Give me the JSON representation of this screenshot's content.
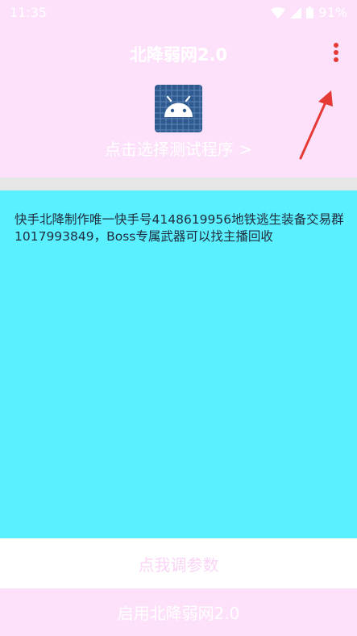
{
  "status_bar": {
    "time": "11:35",
    "battery_percent": "91%",
    "icons": [
      "wifi-icon",
      "signal-icon",
      "battery-icon"
    ]
  },
  "header": {
    "title": "北降弱网2.0",
    "app_icon": "android-icon",
    "select_program": "点击选择测试程序 >",
    "menu_icon": "more-vert-icon"
  },
  "content": {
    "text": "快手北降制作唯一快手号4148619956地铁逃生装备交易群1017993849，Boss专属武器可以找主播回收"
  },
  "buttons": {
    "adjust_params": "点我调参数",
    "enable": "启用北降弱网2.0"
  },
  "colors": {
    "header_bg": "#fde1fa",
    "content_bg": "#5af0ff",
    "annotation_arrow": "#e53935"
  }
}
